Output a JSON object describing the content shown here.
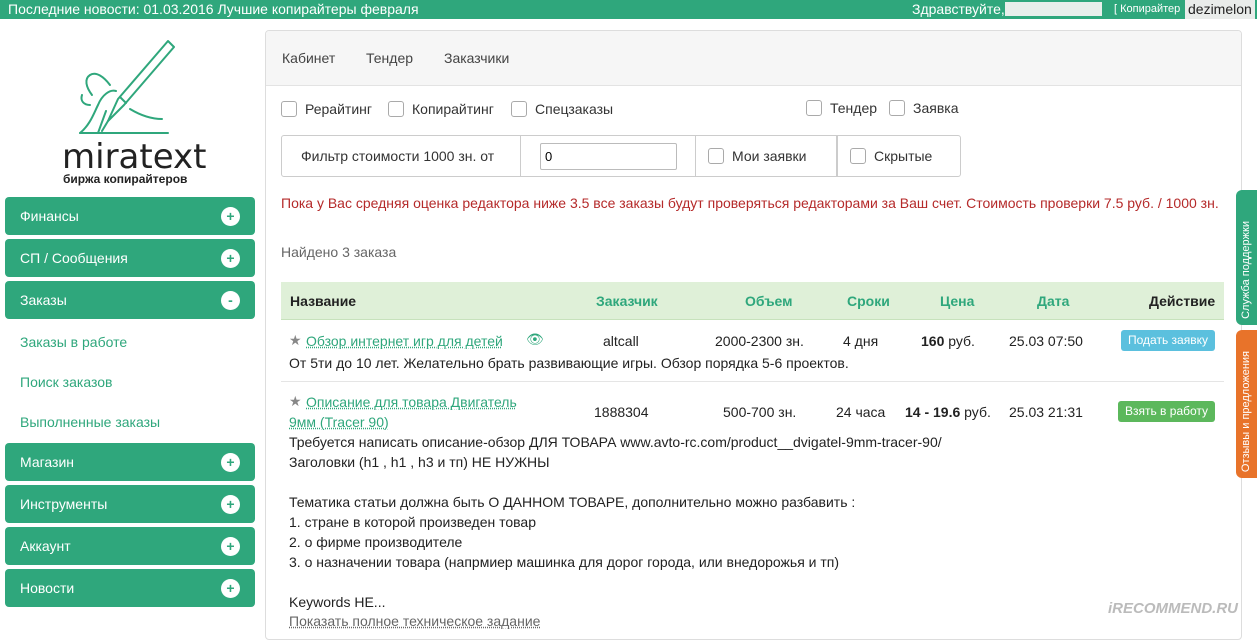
{
  "topbar": {
    "news": "Последние новости: 01.03.2016 Лучшие копирайтеры февраля",
    "greeting": "Здравствуйте,",
    "role": "[ Копирайтер",
    "username": "dezimelon"
  },
  "logo": {
    "brand": "miratext",
    "tagline": "биржа копирайтеров"
  },
  "sidebar": {
    "sections": [
      {
        "label": "Финансы",
        "toggle": "+"
      },
      {
        "label": "СП / Сообщения",
        "toggle": "+"
      },
      {
        "label": "Заказы",
        "toggle": "-"
      },
      {
        "label": "Магазин",
        "toggle": "+"
      },
      {
        "label": "Инструменты",
        "toggle": "+"
      },
      {
        "label": "Аккаунт",
        "toggle": "+"
      },
      {
        "label": "Новости",
        "toggle": "+"
      }
    ],
    "sublinks": [
      "Заказы в работе",
      "Поиск заказов",
      "Выполненные заказы"
    ]
  },
  "nav": {
    "tabs": [
      "Кабинет",
      "Тендер",
      "Заказчики"
    ]
  },
  "filters": {
    "checkboxes": [
      "Рерайтинг",
      "Копирайтинг",
      "Спецзаказы",
      "Тендер",
      "Заявка"
    ],
    "cost_label": "Фильтр стоимости 1000 зн. от",
    "cost_value": "0",
    "my_bids": "Мои заявки",
    "hidden": "Скрытые"
  },
  "warning": "Пока у Вас средняя оценка редактора ниже 3.5 все заказы будут проверяться редакторами за Ваш счет. Стоимость проверки 7.5 руб. / 1000 зн.",
  "found": "Найдено 3 заказа",
  "table": {
    "headers": [
      "Название",
      "Заказчик",
      "Объем",
      "Сроки",
      "Цена",
      "Дата",
      "Действие"
    ],
    "rows": [
      {
        "title": "Обзор интернет игр для детей",
        "customer": "altcall",
        "volume": "2000-2300 зн.",
        "deadline": "4 дня",
        "price_bold": "160",
        "price_unit": " руб.",
        "date": "25.03 07:50",
        "action": "Подать заявку",
        "desc": "От 5ти до 10 лет. Желательно брать развивающие игры. Обзор порядка 5-6 проектов."
      },
      {
        "title_line1": "Описание для товара Двигатель",
        "title_line2": "9мм (Tracer 90)",
        "customer": "1888304",
        "volume": "500-700 зн.",
        "deadline": "24 часа",
        "price_bold": "14 - 19.6",
        "price_unit": " руб.",
        "date": "25.03 21:31",
        "action": "Взять в работу",
        "desc_lines": [
          "Требуется написать описание-обзор ДЛЯ ТОВАРА www.avto-rc.com/product__dvigatel-9mm-tracer-90/",
          "Заголовки (h1 , h1 , h3 и тп) НЕ НУЖНЫ",
          "",
          "Тематика статьи должна быть О ДАННОМ ТОВАРЕ, дополнительно можно разбавить :",
          "1. стране в которой произведен товар",
          "2. о фирме производителе",
          "3. о назначении товара (напрмиер машинка для дорог города, или внедорожья и тп)",
          "",
          "Keywords НЕ..."
        ],
        "more": "Показать полное техническое задание"
      }
    ]
  },
  "side_tabs": {
    "support": "Служба поддержки",
    "reviews": "Отзывы и предложения"
  },
  "watermark": "iRECOMMEND.RU",
  "colors": {
    "brand": "#2fa77c",
    "warning": "#b52a2a",
    "header_bg": "#dff0d8",
    "review_tab": "#e8732a"
  }
}
